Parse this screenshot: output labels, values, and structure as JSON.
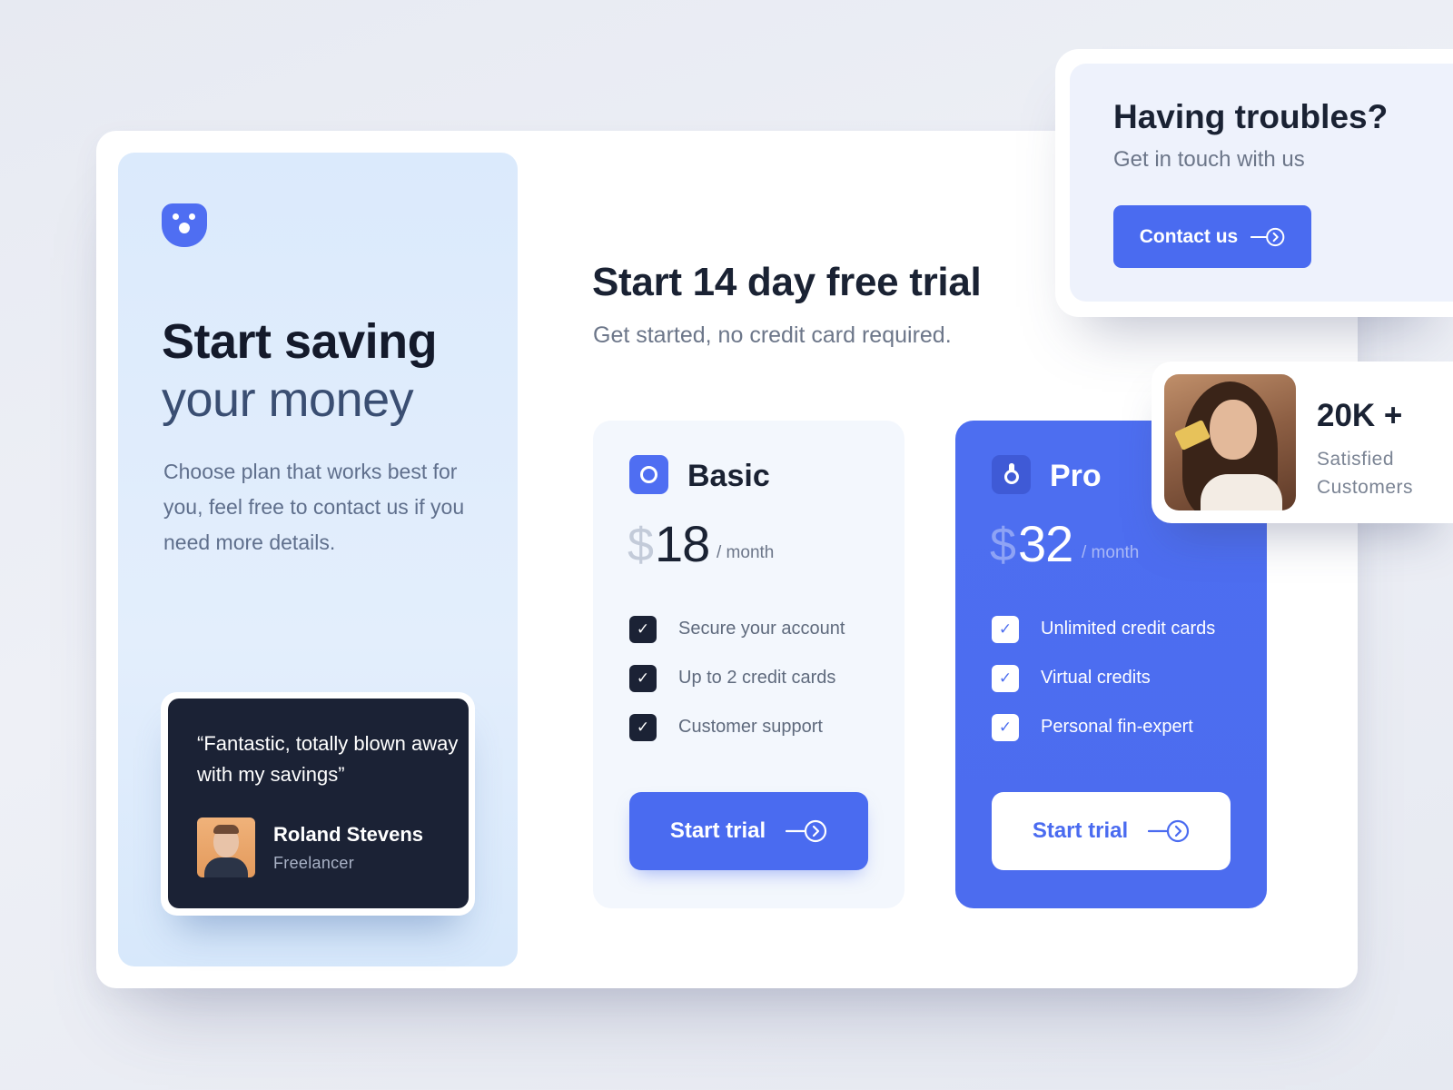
{
  "hero": {
    "title_line1": "Start saving",
    "title_line2": "your money",
    "description": "Choose plan that works best for you, feel free to contact us if you need more details."
  },
  "testimonial": {
    "quote": "“Fantastic, totally blown away with my savings”",
    "author_name": "Roland Stevens",
    "author_role": "Freelancer"
  },
  "trial": {
    "title": "Start 14 day free trial",
    "subtitle": "Get started, no credit card required."
  },
  "plans": [
    {
      "name": "Basic",
      "currency": "$",
      "price": "18",
      "period": "/ month",
      "features": [
        "Secure your account",
        "Up to 2 credit cards",
        "Customer support"
      ],
      "button_label": "Start trial"
    },
    {
      "name": "Pro",
      "currency": "$",
      "price": "32",
      "period": "/ month",
      "features": [
        "Unlimited credit cards",
        "Virtual credits",
        "Personal fin-expert"
      ],
      "button_label": "Start trial"
    }
  ],
  "contact": {
    "title": "Having troubles?",
    "subtitle": "Get in touch with us",
    "button_label": "Contact us"
  },
  "customers": {
    "value": "20K +",
    "label": "Satisfied Customers"
  },
  "colors": {
    "accent": "#4a6bf0",
    "dark": "#1b2235",
    "panel": "#dbeafc"
  },
  "icons": {
    "brand": "brand-logo-icon",
    "basic": "circle-icon",
    "pro": "lock-icon",
    "check": "check-icon",
    "arrow": "arrow-right-circle-icon"
  }
}
